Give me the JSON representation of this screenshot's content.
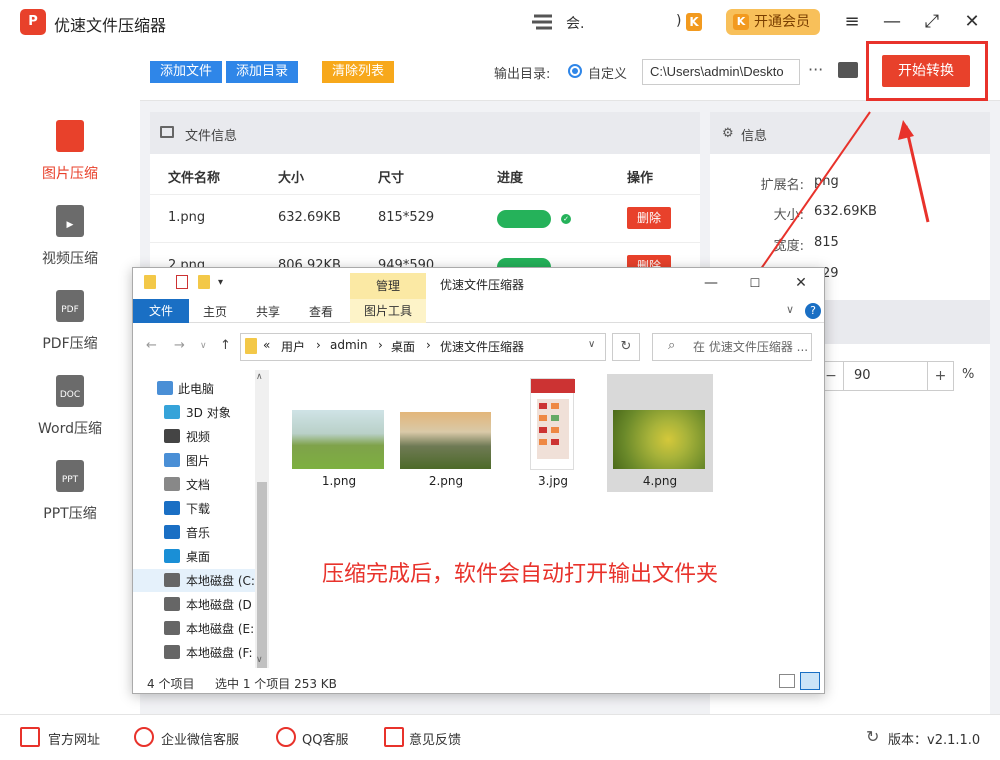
{
  "app": {
    "logo": "P",
    "title": "优速文件压缩器",
    "user_name": "会.",
    "user_end": ")",
    "vip_k": "K",
    "vip_label": "开通会员",
    "menu_icon": "≡",
    "minimize": "—",
    "maximize": "⤢",
    "close": "✕"
  },
  "sidebar": {
    "items": [
      {
        "label": "图片压缩",
        "icon_text": "",
        "color": "#e8412b",
        "active": true
      },
      {
        "label": "视频压缩",
        "icon_text": "▶",
        "color": "#6b6b6b"
      },
      {
        "label": "PDF压缩",
        "icon_text": "PDF",
        "color": "#6b6b6b"
      },
      {
        "label": "Word压缩",
        "icon_text": "DOC",
        "color": "#6b6b6b"
      },
      {
        "label": "PPT压缩",
        "icon_text": "PPT",
        "color": "#6b6b6b"
      }
    ]
  },
  "toolbar": {
    "add_file": "添加文件",
    "add_dir": "添加目录",
    "clear_list": "清除列表",
    "output_label": "输出目录:",
    "custom_label": "自定义",
    "path": "C:\\Users\\admin\\Deskto",
    "more": "···",
    "start": "开始转换"
  },
  "file_info": {
    "title": "文件信息",
    "columns": [
      "文件名称",
      "大小",
      "尺寸",
      "进度",
      "操作"
    ],
    "rows": [
      {
        "name": "1.png",
        "size": "632.69KB",
        "dim": "815*529",
        "action": "删除"
      },
      {
        "name": "2.png",
        "size": "806.92KB",
        "dim": "949*590",
        "action": "删除"
      }
    ],
    "check": "✓"
  },
  "info": {
    "title": "信息",
    "ext_label": "扩展名:",
    "ext_value": "png",
    "size_label": "大小:",
    "size_value": "632.69KB",
    "width_label": "宽度:",
    "width_value": "815",
    "height_value": "29",
    "gear": "⚙"
  },
  "quality": {
    "minus": "−",
    "value": "90",
    "plus": "+",
    "unit": "%"
  },
  "footer": {
    "website": "官方网址",
    "wechat": "企业微信客服",
    "qq": "QQ客服",
    "feedback": "意见反馈",
    "version": "版本：v2.1.1.0"
  },
  "explorer": {
    "manage": "管理",
    "title": "优速文件压缩器",
    "tabs": {
      "file": "文件",
      "home": "主页",
      "share": "共享",
      "view": "查看",
      "pic_tools": "图片工具"
    },
    "breadcrumb": [
      "«",
      "用户",
      "›",
      "admin",
      "›",
      "桌面",
      "›",
      "优速文件压缩器"
    ],
    "search_placeholder": "在 优速文件压缩器 ...",
    "nav": [
      {
        "label": "此电脑",
        "color": "#4a8fd6"
      },
      {
        "label": "3D 对象",
        "color": "#36a3d9"
      },
      {
        "label": "视频",
        "color": "#444"
      },
      {
        "label": "图片",
        "color": "#4a8fd6"
      },
      {
        "label": "文档",
        "color": "#888"
      },
      {
        "label": "下载",
        "color": "#1a6fc4"
      },
      {
        "label": "音乐",
        "color": "#1a6fc4"
      },
      {
        "label": "桌面",
        "color": "#1a8fd6"
      },
      {
        "label": "本地磁盘 (C:",
        "color": "#666"
      },
      {
        "label": "本地磁盘 (D",
        "color": "#666"
      },
      {
        "label": "本地磁盘 (E:",
        "color": "#666"
      },
      {
        "label": "本地磁盘 (F:",
        "color": "#666"
      }
    ],
    "files": [
      "1.png",
      "2.png",
      "3.jpg",
      "4.png"
    ],
    "annotation": "压缩完成后，软件会自动打开输出文件夹",
    "status_count": "4 个项目",
    "status_selected": "选中 1 个项目  253 KB"
  }
}
